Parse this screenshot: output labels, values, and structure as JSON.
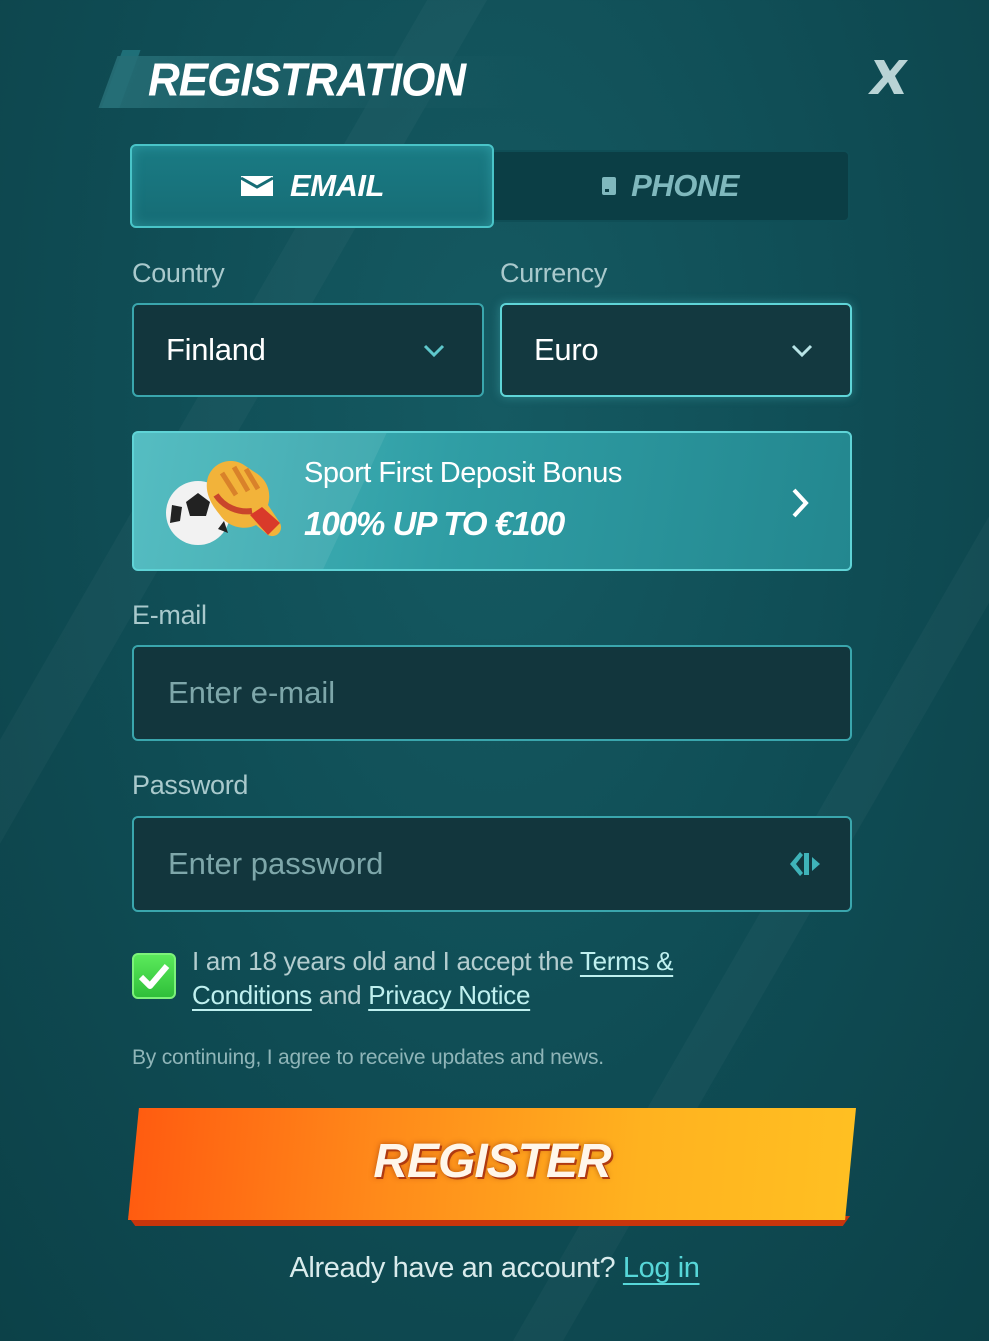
{
  "header": {
    "title": "REGISTRATION",
    "close_icon": "close-icon"
  },
  "tabs": [
    {
      "label": "EMAIL",
      "icon": "envelope-icon",
      "active": true
    },
    {
      "label": "PHONE",
      "icon": "phone-icon",
      "active": false
    }
  ],
  "country": {
    "label": "Country",
    "value": "Finland"
  },
  "currency": {
    "label": "Currency",
    "value": "Euro"
  },
  "bonus": {
    "title": "Sport First Deposit Bonus",
    "amount": "100% UP TO €100"
  },
  "email": {
    "label": "E-mail",
    "placeholder": "Enter e-mail"
  },
  "password": {
    "label": "Password",
    "placeholder": "Enter password"
  },
  "consent": {
    "checked": true,
    "text_before": "I am 18 years old and I accept the ",
    "terms_link": "Terms & Conditions",
    "text_middle": " and ",
    "privacy_link": "Privacy Notice"
  },
  "agree_note": "By continuing, I agree to receive updates and news.",
  "register_label": "REGISTER",
  "footer": {
    "question": "Already have an account? ",
    "login_link": "Log in"
  },
  "colors": {
    "background": "#0f4c54",
    "accent": "#5fd5d8",
    "cta": "#ff8a1a",
    "checkbox": "#3ccf45"
  }
}
